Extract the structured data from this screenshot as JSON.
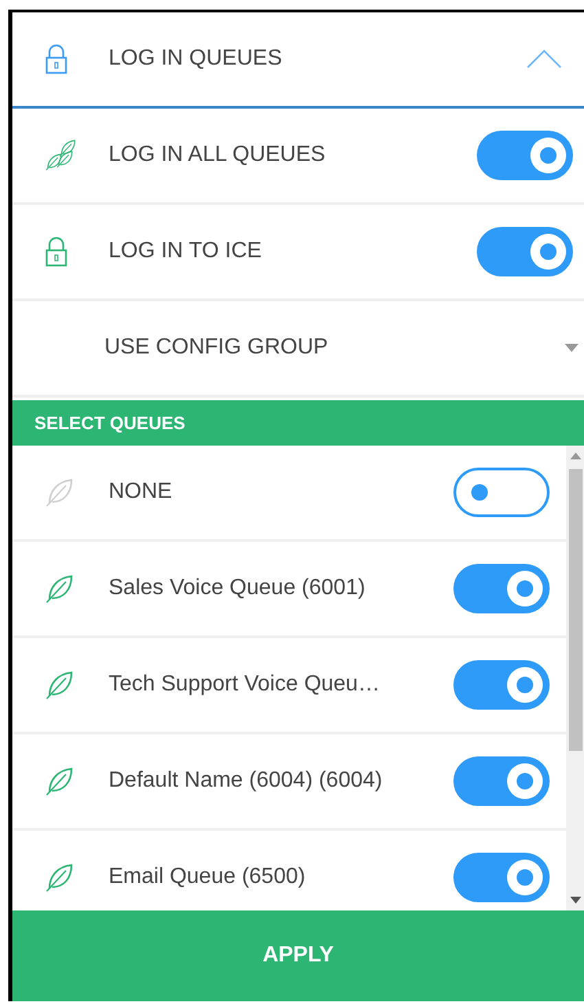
{
  "header": {
    "title": "LOG IN QUEUES",
    "expanded": true
  },
  "options": [
    {
      "kind": "toggle",
      "label": "LOG IN ALL QUEUES",
      "on": true
    },
    {
      "kind": "toggle",
      "label": "LOG IN TO ICE",
      "on": true
    },
    {
      "kind": "dropdown",
      "label": "USE CONFIG GROUP"
    }
  ],
  "section_title": "SELECT QUEUES",
  "queues": [
    {
      "name": "NONE",
      "on": false
    },
    {
      "name": "Sales Voice Queue (6001)",
      "on": true
    },
    {
      "name": "Tech Support Voice Queu…",
      "on": true
    },
    {
      "name": "Default Name (6004) (6004)",
      "on": true
    },
    {
      "name": "Email Queue (6500)",
      "on": true
    }
  ],
  "apply_button": "APPLY"
}
